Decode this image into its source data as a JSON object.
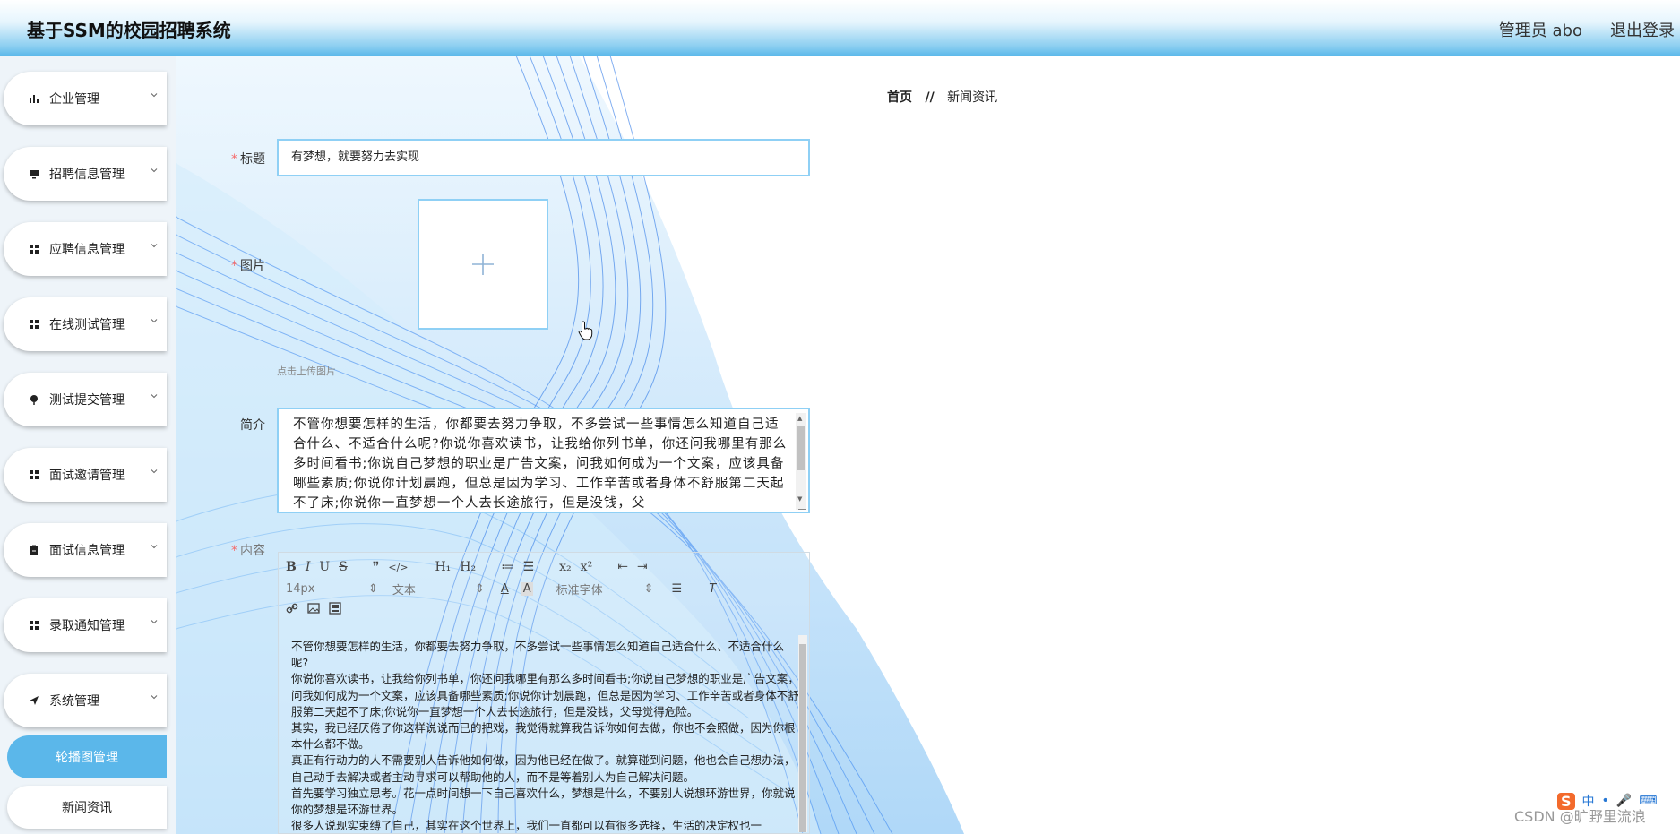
{
  "app": {
    "title": "基于SSM的校园招聘系统"
  },
  "header": {
    "admin_label": "管理员 abo",
    "logout_label": "退出登录"
  },
  "sidebar": {
    "items": [
      {
        "label": "企业管理",
        "icon": "bar-chart-icon"
      },
      {
        "label": "招聘信息管理",
        "icon": "monitor-icon"
      },
      {
        "label": "应聘信息管理",
        "icon": "grid-icon"
      },
      {
        "label": "在线测试管理",
        "icon": "grid-icon"
      },
      {
        "label": "测试提交管理",
        "icon": "pin-icon"
      },
      {
        "label": "面试邀请管理",
        "icon": "grid-icon"
      },
      {
        "label": "面试信息管理",
        "icon": "clipboard-icon"
      },
      {
        "label": "录取通知管理",
        "icon": "grid-icon"
      },
      {
        "label": "系统管理",
        "icon": "send-icon"
      }
    ],
    "sub_items": [
      {
        "label": "轮播图管理",
        "active": true
      },
      {
        "label": "新闻资讯",
        "active": false
      }
    ]
  },
  "breadcrumb": {
    "home": "首页",
    "separator": "//",
    "current": "新闻资讯"
  },
  "form": {
    "title_label": "标题",
    "title_value": "有梦想，就要努力去实现",
    "image_label": "图片",
    "upload_hint": "点击上传图片",
    "intro_label": "简介",
    "intro_value": "不管你想要怎样的生活，你都要去努力争取，不多尝试一些事情怎么知道自己适合什么、不适合什么呢?你说你喜欢读书，让我给你列书单，你还问我哪里有那么多时间看书;你说自己梦想的职业是广告文案，问我如何成为一个文案，应该具备哪些素质;你说你计划晨跑，但总是因为学习、工作辛苦或者身体不舒服第二天起不了床;你说你一直梦想一个人去长途旅行，但是没钱，父",
    "content_label": "内容"
  },
  "editor": {
    "toolbar_row1": [
      "B",
      "I",
      "U",
      "S",
      "❞",
      "</>",
      "H₁",
      "H₂",
      "≔",
      "☰",
      "x₂",
      "x²",
      "⇤",
      "⇥"
    ],
    "font_size": "14px",
    "text_style": "文本",
    "font_family": "标准字体",
    "paragraphs": [
      "不管你想要怎样的生活，你都要去努力争取，不多尝试一些事情怎么知道自己适合什么、不适合什么呢?",
      "你说你喜欢读书，让我给你列书单，你还问我哪里有那么多时间看书;你说自己梦想的职业是广告文案，问我如何成为一个文案，应该具备哪些素质;你说你计划晨跑，但总是因为学习、工作辛苦或者身体不舒服第二天起不了床;你说你一直梦想一个人去长途旅行，但是没钱，父母觉得危险。",
      "其实，我已经厌倦了你这样说说而已的把戏，我觉得就算我告诉你如何去做，你也不会照做，因为你根本什么都不做。",
      "真正有行动力的人不需要别人告诉他如何做，因为他已经在做了。就算碰到问题，他也会自己想办法，自己动手去解决或者主动寻求可以帮助他的人，而不是等着别人为自己解决问题。",
      "首先要学习独立思考。花一点时间想一下自己喜欢什么，梦想是什么，不要别人说想环游世界，你就说你的梦想是环游世界。",
      "很多人说现实束缚了自己，其实在这个世界上，我们一直都可以有很多选择，生活的决定权也一"
    ]
  },
  "watermark": "CSDN @旷野里流浪",
  "tray": {
    "ime_logo": "S",
    "ime_mode": "中"
  },
  "colors": {
    "accent": "#5bb7ea",
    "border": "#8fd0f5",
    "required": "#f56c6c"
  }
}
